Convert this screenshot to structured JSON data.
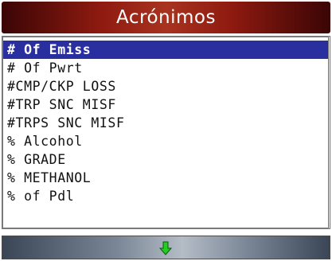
{
  "header": {
    "title": "Acrónimos"
  },
  "list": {
    "items": [
      {
        "label": "# Of Emiss",
        "selected": true
      },
      {
        "label": "# Of Pwrt",
        "selected": false
      },
      {
        "label": "#CMP/CKP LOSS",
        "selected": false
      },
      {
        "label": "#TRP SNC MISF",
        "selected": false
      },
      {
        "label": "#TRPS SNC MISF",
        "selected": false
      },
      {
        "label": "% Alcohol",
        "selected": false
      },
      {
        "label": "% GRADE",
        "selected": false
      },
      {
        "label": "% METHANOL",
        "selected": false
      },
      {
        "label": "% of Pdl",
        "selected": false
      }
    ]
  },
  "footer": {
    "icon": "arrow-down-icon",
    "icon_color": "#22cc22"
  },
  "colors": {
    "title_bar": "#8e1a10",
    "selection": "#2a2fa0",
    "footer_bar": "#7a8696"
  }
}
